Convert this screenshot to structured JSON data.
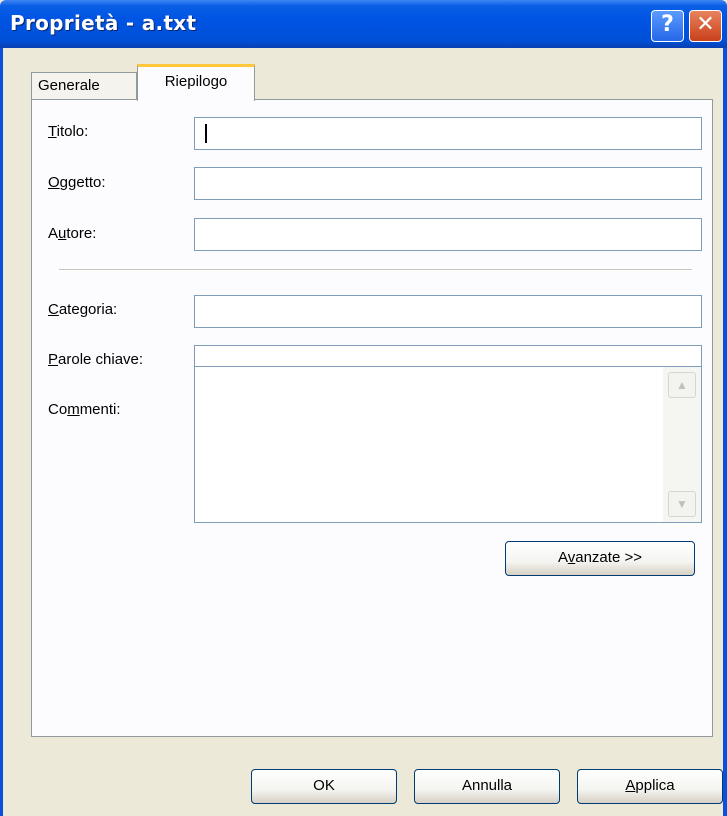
{
  "window": {
    "title": "Proprietà - a.txt",
    "help_glyph": "?",
    "close_glyph": "✕"
  },
  "tabs": [
    {
      "label": "Generale",
      "selected": false
    },
    {
      "label": "Riepilogo",
      "selected": true
    }
  ],
  "fields": {
    "titolo": {
      "mnemonic": "T",
      "label_rest": "itolo:",
      "value": ""
    },
    "oggetto": {
      "mnemonic": "O",
      "label_rest": "ggetto:",
      "value": ""
    },
    "autore": {
      "label_pre": "A",
      "mnemonic": "u",
      "label_rest": "tore:",
      "value": ""
    },
    "categoria": {
      "mnemonic": "C",
      "label_rest": "ategoria:",
      "value": ""
    },
    "parole_chiave": {
      "mnemonic": "P",
      "label_rest": "arole chiave:",
      "value": ""
    },
    "commenti": {
      "label_pre": "Co",
      "mnemonic": "m",
      "label_rest": "menti:",
      "value": ""
    }
  },
  "buttons": {
    "avanzate": {
      "label_pre": "A",
      "mnemonic": "v",
      "label_rest": "anzate >>"
    },
    "ok": "OK",
    "annulla": "Annulla",
    "applica": {
      "mnemonic": "A",
      "label_rest": "pplica"
    }
  },
  "colors": {
    "titlebar": "#0054e3",
    "dialog_bg": "#ece9d8",
    "tab_accent": "#ffc83c",
    "field_border": "#7f9db9"
  },
  "icons": {
    "scroll_up": "▲",
    "scroll_down": "▼"
  }
}
